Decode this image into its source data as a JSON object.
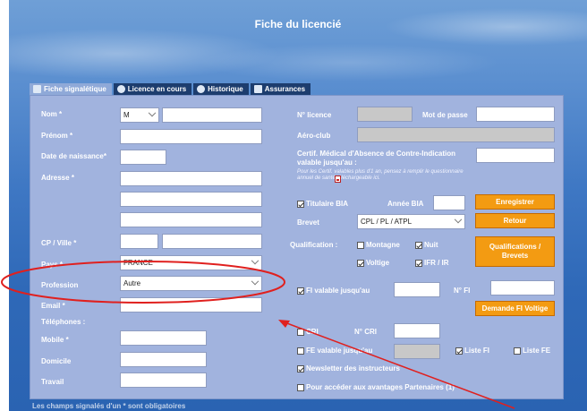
{
  "page": {
    "title": "Fiche du licencié"
  },
  "tabs": [
    {
      "label": "Fiche signalétique",
      "icon": "id-card-icon"
    },
    {
      "label": "Licence en cours",
      "icon": "license-icon"
    },
    {
      "label": "Historique",
      "icon": "history-icon"
    },
    {
      "label": "Assurances",
      "icon": "document-icon"
    }
  ],
  "left": {
    "nom_label": "Nom",
    "civilite_value": "M",
    "prenom_label": "Prénom",
    "naissance_label": "Date de naissance",
    "adresse_label": "Adresse",
    "cp_ville_label": "CP / Ville",
    "pays_label": "Pays",
    "pays_value": "FRANCE",
    "profession_label": "Profession",
    "profession_value": "Autre",
    "email_label": "Email",
    "telephones_label": "Téléphones :",
    "mobile_label": "Mobile",
    "domicile_label": "Domicile",
    "travail_label": "Travail",
    "required_mark": "*"
  },
  "right": {
    "licence_label": "N° licence",
    "mdp_label": "Mot de passe",
    "aeroclub_label": "Aéro-club",
    "certif_label": "Certif. Médical d'Absence de Contre-Indication valable jusqu'au :",
    "certif_note": "Pour les Certif. valables plus d'1 an, pensez à remplir le questionnaire annuel de santé téléchargeable ici.",
    "bia_label": "Titulaire BIA",
    "annee_bia_label": "Année BIA",
    "brevet_label": "Brevet",
    "brevet_value": "CPL / PL / ATPL",
    "qualification_label": "Qualification :",
    "montagne_label": "Montagne",
    "nuit_label": "Nuit",
    "voltige_label": "Voltige",
    "ifr_label": "IFR / IR",
    "fi_label": "FI valable jusqu'au",
    "nfi_label": "N° FI",
    "cri_label": "CRI",
    "ncri_label": "N° CRI",
    "fe_label": "FE valable jusqu'au",
    "liste_fi_label": "Liste FI",
    "liste_fe_label": "Liste FE",
    "newsletter_label": "Newsletter des instructeurs",
    "partenaires_label": "Pour accéder aux avantages Partenaires (1)"
  },
  "buttons": {
    "enregistrer": "Enregistrer",
    "retour": "Retour",
    "qualifications": "Qualifications / Brevets",
    "demande_fi": "Demande FI Voltige"
  },
  "footer": {
    "text": "Les champs signalés d'un * sont obligatoires"
  },
  "annotation_color": "#e0201e"
}
